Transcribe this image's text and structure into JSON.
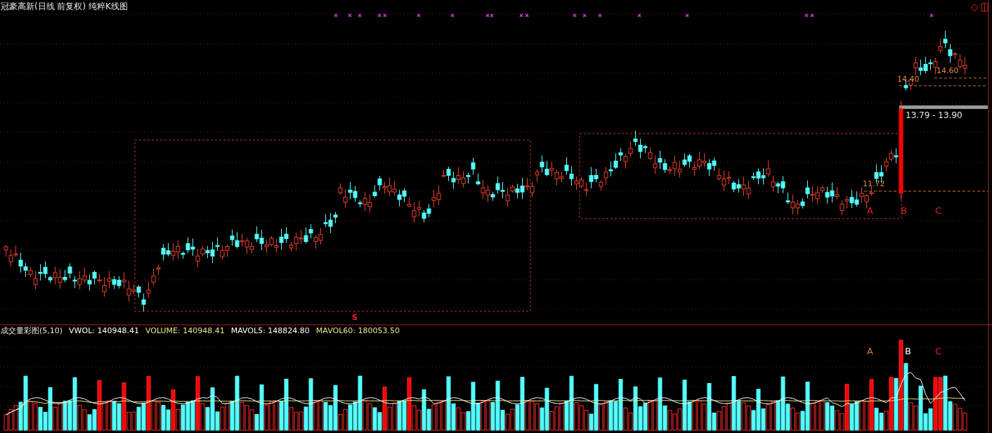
{
  "title": "冠豪高新(日线 前复权) 纯粹K线图",
  "price_panel": {
    "price_labels": [
      {
        "text": "14.60",
        "kind": "level"
      },
      {
        "text": "14.40",
        "kind": "level"
      },
      {
        "text": "13.79 - 13.90",
        "kind": "gap"
      },
      {
        "text": "11.72",
        "kind": "level"
      }
    ],
    "point_labels": [
      "A",
      "B",
      "C"
    ],
    "signal_mark": "S"
  },
  "volume_panel": {
    "indicator": "成交量彩图(5,10)",
    "readouts": [
      {
        "text": "VWOL: 140948.41",
        "color": "#ffffff"
      },
      {
        "text": "VOLUME: 140948.41",
        "color": "#e6e68c"
      },
      {
        "text": "MAVOL5: 148824.80",
        "color": "#ffffff"
      },
      {
        "text": "MAVOL60: 180053.50",
        "color": "#e6e68c"
      }
    ],
    "point_labels": [
      {
        "text": "A",
        "color": "#e07830"
      },
      {
        "text": "B",
        "color": "#ffffff"
      },
      {
        "text": "C",
        "color": "#e02020"
      }
    ]
  }
}
